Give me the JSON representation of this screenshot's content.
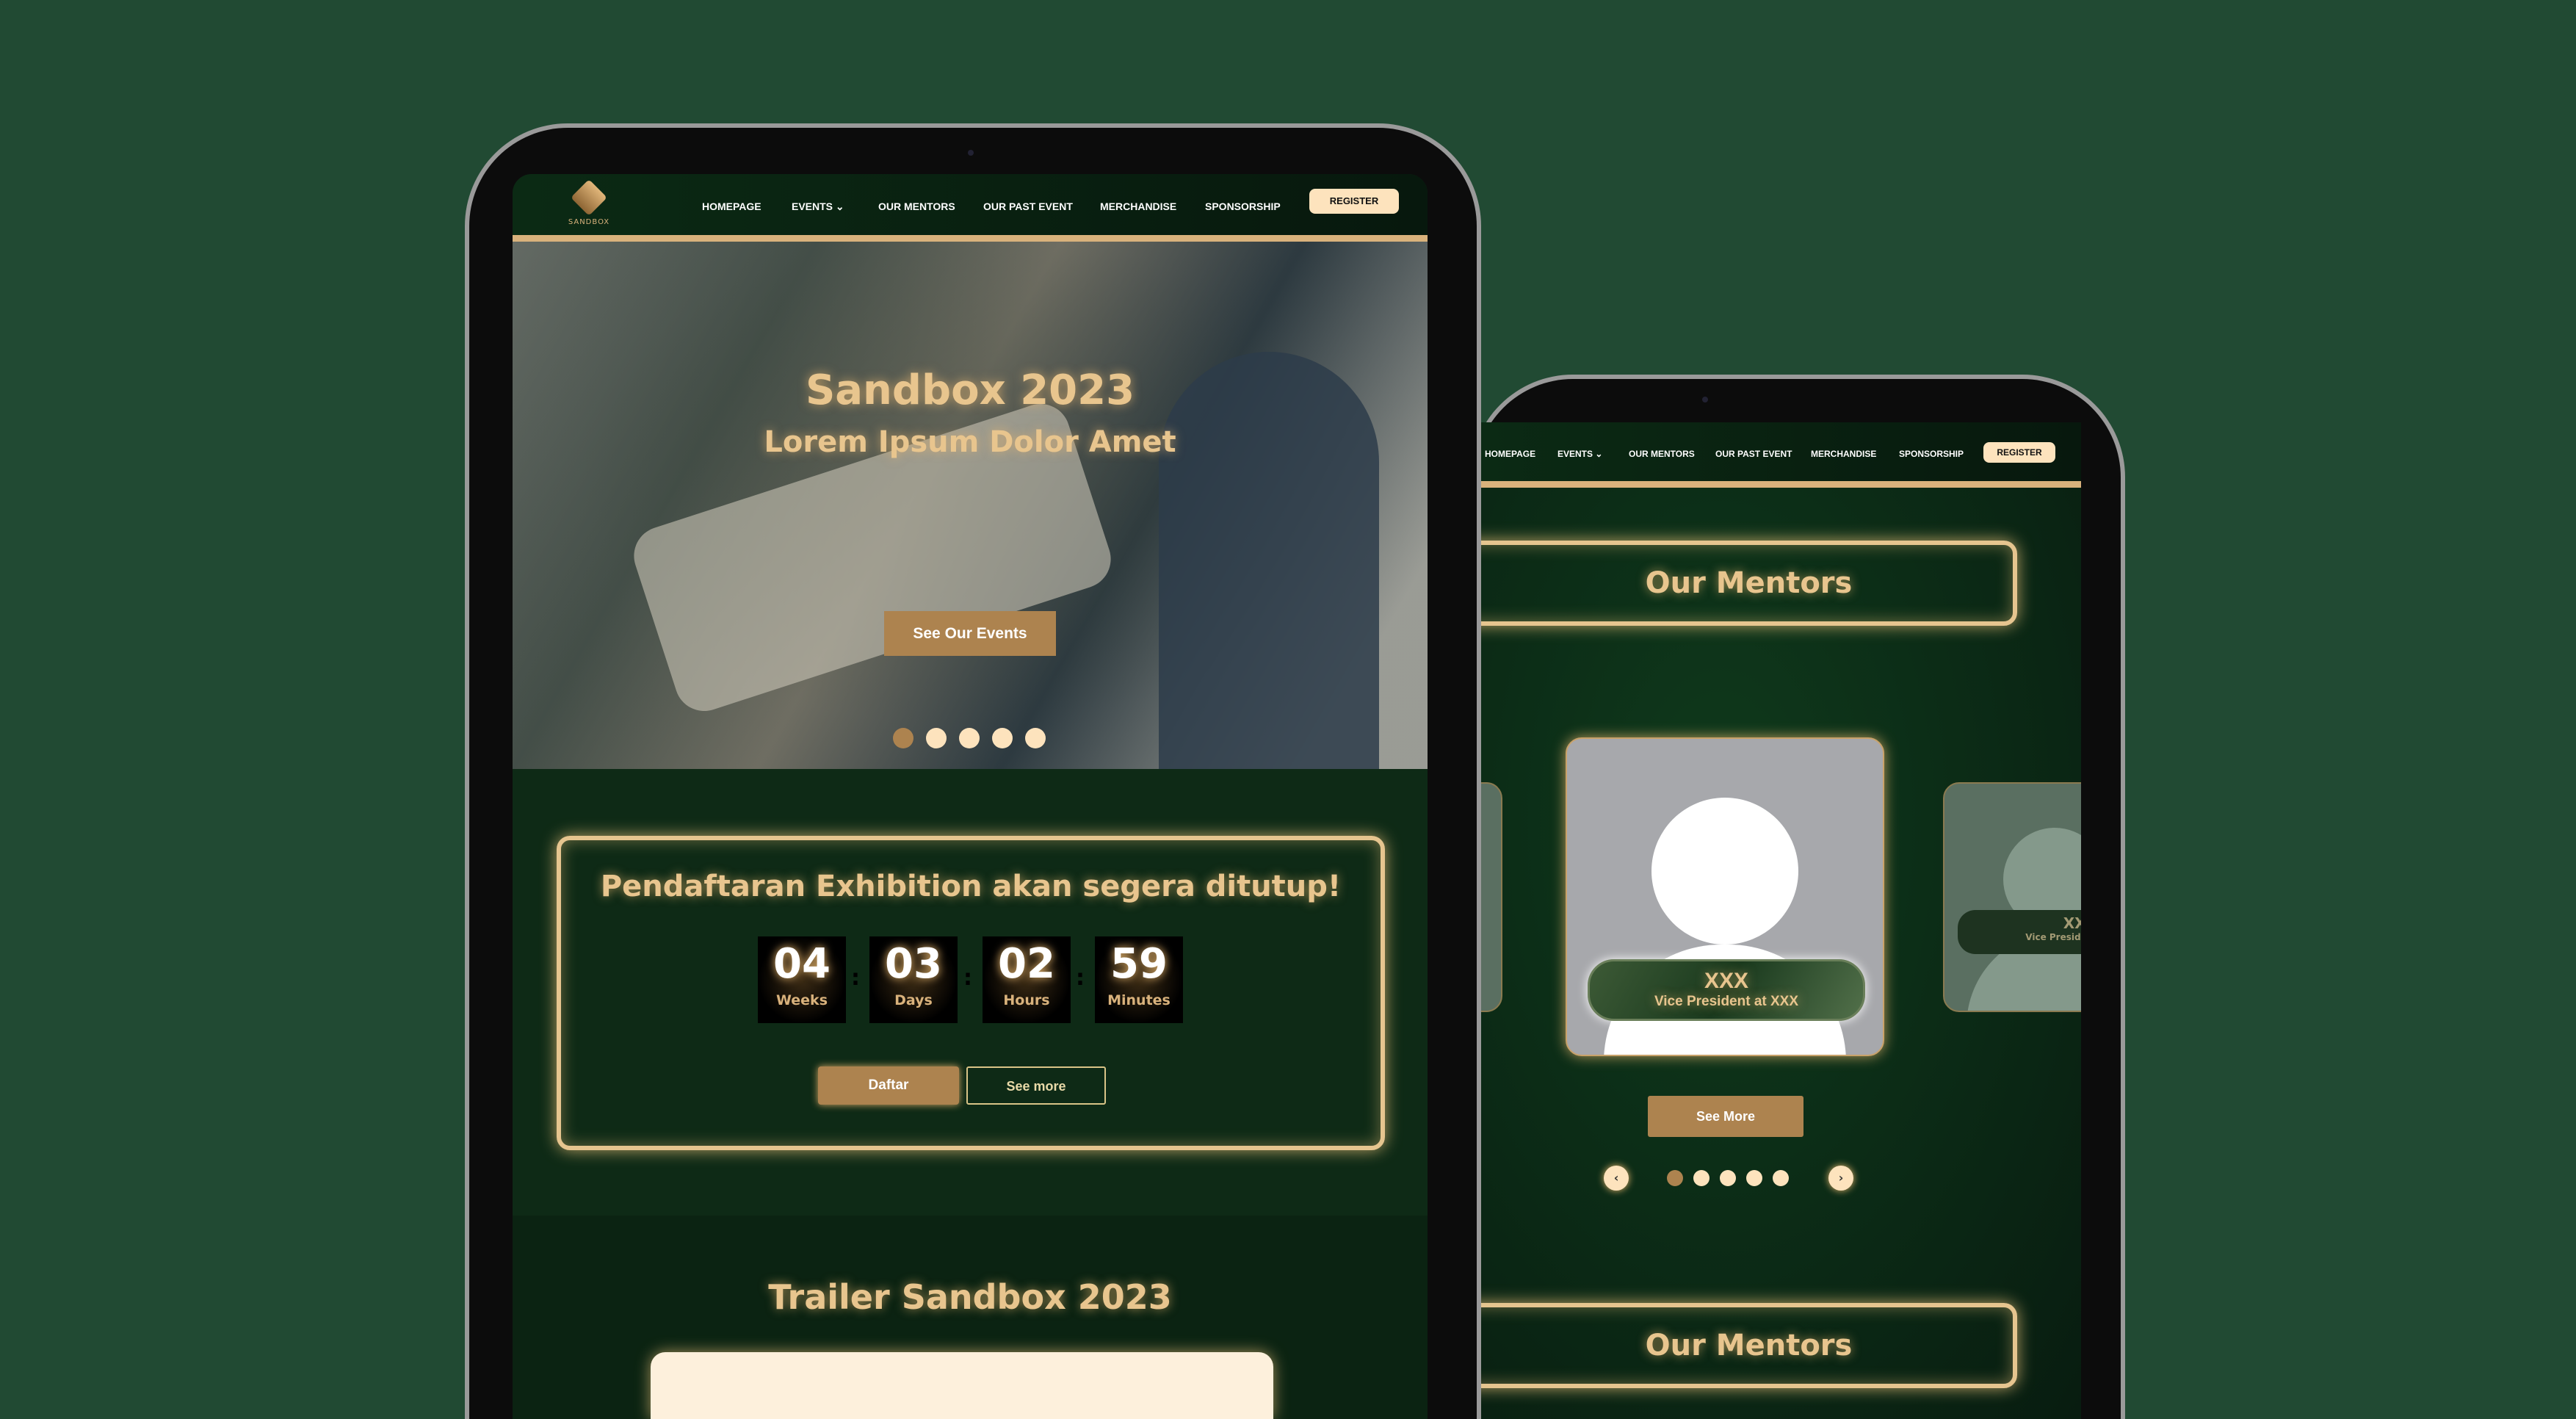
{
  "nav": {
    "items": [
      "HOMEPAGE",
      "EVENTS",
      "OUR MENTORS",
      "OUR PAST EVENT",
      "MERCHANDISE",
      "SPONSORSHIP"
    ],
    "register": "REGISTER",
    "logo_text": "SANDBOX"
  },
  "hero": {
    "title": "Sandbox 2023",
    "subtitle": "Lorem Ipsum Dolor Amet",
    "cta": "See Our Events",
    "slides": 5,
    "active_slide": 1
  },
  "countdown": {
    "title": "Pendaftaran Exhibition akan segera ditutup!",
    "units": [
      {
        "value": "04",
        "label": "Weeks"
      },
      {
        "value": "03",
        "label": "Days"
      },
      {
        "value": "02",
        "label": "Hours"
      },
      {
        "value": "59",
        "label": "Minutes"
      }
    ],
    "primary": "Daftar",
    "secondary": "See more"
  },
  "trailer": {
    "title": "Trailer Sandbox 2023"
  },
  "mentors": {
    "title": "Our Mentors",
    "title2": "Our Mentors",
    "card": {
      "name": "XXX",
      "role": "Vice President at XXX"
    },
    "side_card": {
      "name": "XXX",
      "role": "Vice President"
    },
    "see_more": "See More",
    "slides": 5,
    "active_slide": 1
  },
  "colors": {
    "bg": "#214a33",
    "gold": "#e8c58e",
    "accent": "#ad834f",
    "cream": "#fde3bd"
  }
}
